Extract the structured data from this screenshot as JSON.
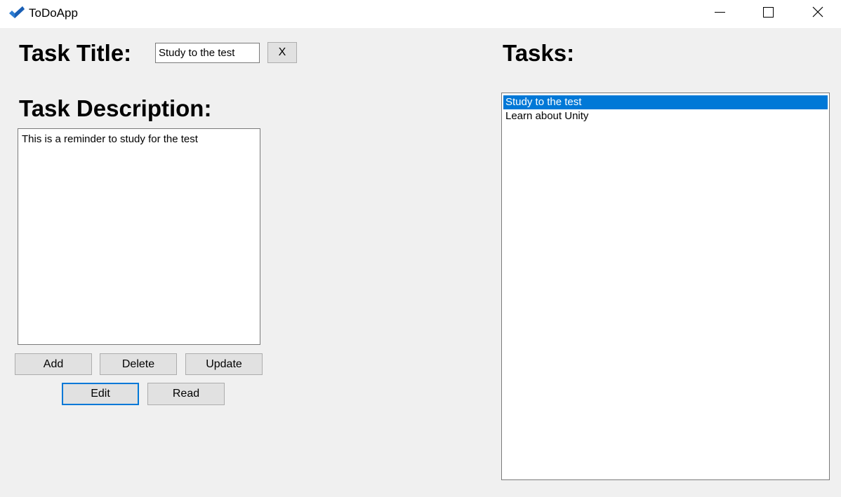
{
  "window": {
    "title": "ToDoApp",
    "icon": "checkmark-icon",
    "controls": [
      "minimize-icon",
      "maximize-icon",
      "close-icon"
    ]
  },
  "form": {
    "title_label": "Task Title:",
    "title_value": "Study to the test",
    "clear_button_label": "X",
    "description_label": "Task Description:",
    "description_value": "This is a reminder to study for the test"
  },
  "actions": {
    "add_label": "Add",
    "delete_label": "Delete",
    "update_label": "Update",
    "edit_label": "Edit",
    "read_label": "Read"
  },
  "tasks": {
    "label": "Tasks:",
    "items": [
      {
        "label": "Study to the test",
        "selected": true
      },
      {
        "label": "Learn about Unity",
        "selected": false
      }
    ]
  },
  "colors": {
    "accent": "#0078d7",
    "background": "#f0f0f0",
    "button": "#e1e1e1"
  }
}
